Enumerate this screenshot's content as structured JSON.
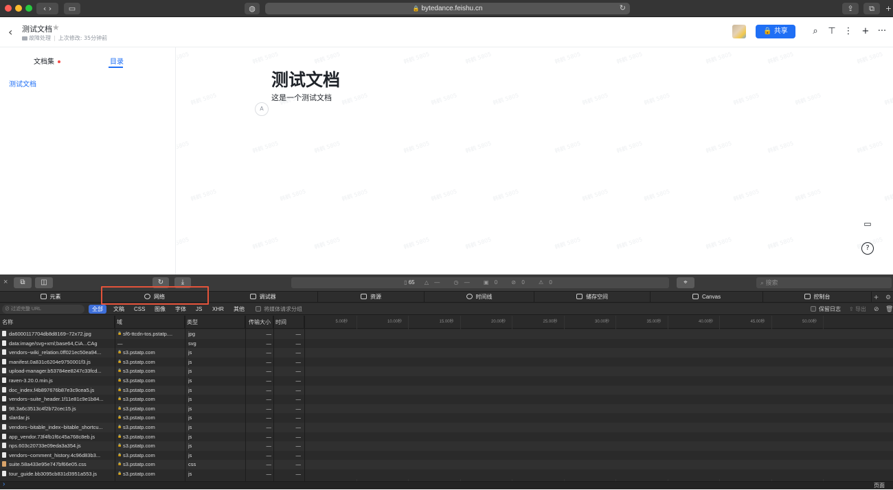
{
  "browser": {
    "url": "bytedance.feishu.cn"
  },
  "doc_header": {
    "title": "测试文档",
    "folder": "故障处理",
    "modified": "上次修改: 35分钟前",
    "share_label": "共享"
  },
  "sidebar": {
    "tab_docset": "文档集",
    "tab_toc": "目录",
    "toc_item": "测试文档"
  },
  "content": {
    "heading": "测试文档",
    "paragraph": "这是一个测试文档",
    "para_handle": "A",
    "watermark": "韩鹤 5805"
  },
  "devtools": {
    "status": {
      "resources": "65",
      "size": "—",
      "time": "—",
      "errors": "0",
      "warnings": "0",
      "issues": "0"
    },
    "search_placeholder": "搜索",
    "tabs": [
      "元素",
      "网络",
      "调试器",
      "资源",
      "时间线",
      "储存空间",
      "Canvas",
      "控制台"
    ],
    "filter_placeholder": "过滤完整 URL",
    "filter_types": [
      "全部",
      "文稿",
      "CSS",
      "图像",
      "字体",
      "JS",
      "XHR",
      "其他"
    ],
    "group_media": "将媒体请求分组",
    "keep_log": "保留日志",
    "export": "导出",
    "columns": [
      "名称",
      "域",
      "类型",
      "传输大小",
      "时间"
    ],
    "timeline_ticks": [
      "5.00秒",
      "10.00秒",
      "15.00秒",
      "20.00秒",
      "25.00秒",
      "30.00秒",
      "35.00秒",
      "40.00秒",
      "45.00秒",
      "50.00秒"
    ],
    "rows": [
      {
        "name": "da6000117704db8d8169~72x72.jpg",
        "domain": "sf6-ttcdn-tos.pstatp....",
        "type": "jpg",
        "size": "—",
        "time": "—"
      },
      {
        "name": "data:image/svg+xml;base64,CiA...CAg",
        "domain": "—",
        "type": "svg",
        "size": "—",
        "time": "—"
      },
      {
        "name": "vendors~wiki_relation.0ff021ec50ea94...",
        "domain": "s3.pstatp.com",
        "type": "js",
        "size": "—",
        "time": "—"
      },
      {
        "name": "manifest.0a831c6204e9750001f3.js",
        "domain": "s3.pstatp.com",
        "type": "js",
        "size": "—",
        "time": "—"
      },
      {
        "name": "upload-manager.b53784ee8247c33fcd...",
        "domain": "s3.pstatp.com",
        "type": "js",
        "size": "—",
        "time": "—"
      },
      {
        "name": "raven-3.20.0.min.js",
        "domain": "s3.pstatp.com",
        "type": "js",
        "size": "—",
        "time": "—"
      },
      {
        "name": "doc_index.f4b897676b87e3c9cea5.js",
        "domain": "s3.pstatp.com",
        "type": "js",
        "size": "—",
        "time": "—"
      },
      {
        "name": "vendors~suite_header.1f11e81c9e1b84...",
        "domain": "s3.pstatp.com",
        "type": "js",
        "size": "—",
        "time": "—"
      },
      {
        "name": "98.3a6c3513c4f2b72cec15.js",
        "domain": "s3.pstatp.com",
        "type": "js",
        "size": "—",
        "time": "—"
      },
      {
        "name": "slardar.js",
        "domain": "s3.pstatp.com",
        "type": "js",
        "size": "—",
        "time": "—"
      },
      {
        "name": "vendors~bitable_index~bitable_shortcu...",
        "domain": "s3.pstatp.com",
        "type": "js",
        "size": "—",
        "time": "—"
      },
      {
        "name": "app_vendor.73f4fb1f6c45a768c8eb.js",
        "domain": "s3.pstatp.com",
        "type": "js",
        "size": "—",
        "time": "—"
      },
      {
        "name": "nps.603c20733e09eda3a354.js",
        "domain": "s3.pstatp.com",
        "type": "js",
        "size": "—",
        "time": "—"
      },
      {
        "name": "vendors~comment_history.4c96d83b3...",
        "domain": "s3.pstatp.com",
        "type": "js",
        "size": "—",
        "time": "—"
      },
      {
        "name": "suite.58a433e95e747bf66e05.css",
        "domain": "s3.pstatp.com",
        "type": "css",
        "size": "—",
        "time": "—"
      },
      {
        "name": "tour_guide.bb3095cb831d3951a553.js",
        "domain": "s3.pstatp.com",
        "type": "js",
        "size": "—",
        "time": "—"
      }
    ],
    "page_label": "页面"
  },
  "colors": {
    "accent": "#1f6ff5",
    "highlight_box": "#e5533a",
    "devtools_bg": "#2a2a2a"
  }
}
